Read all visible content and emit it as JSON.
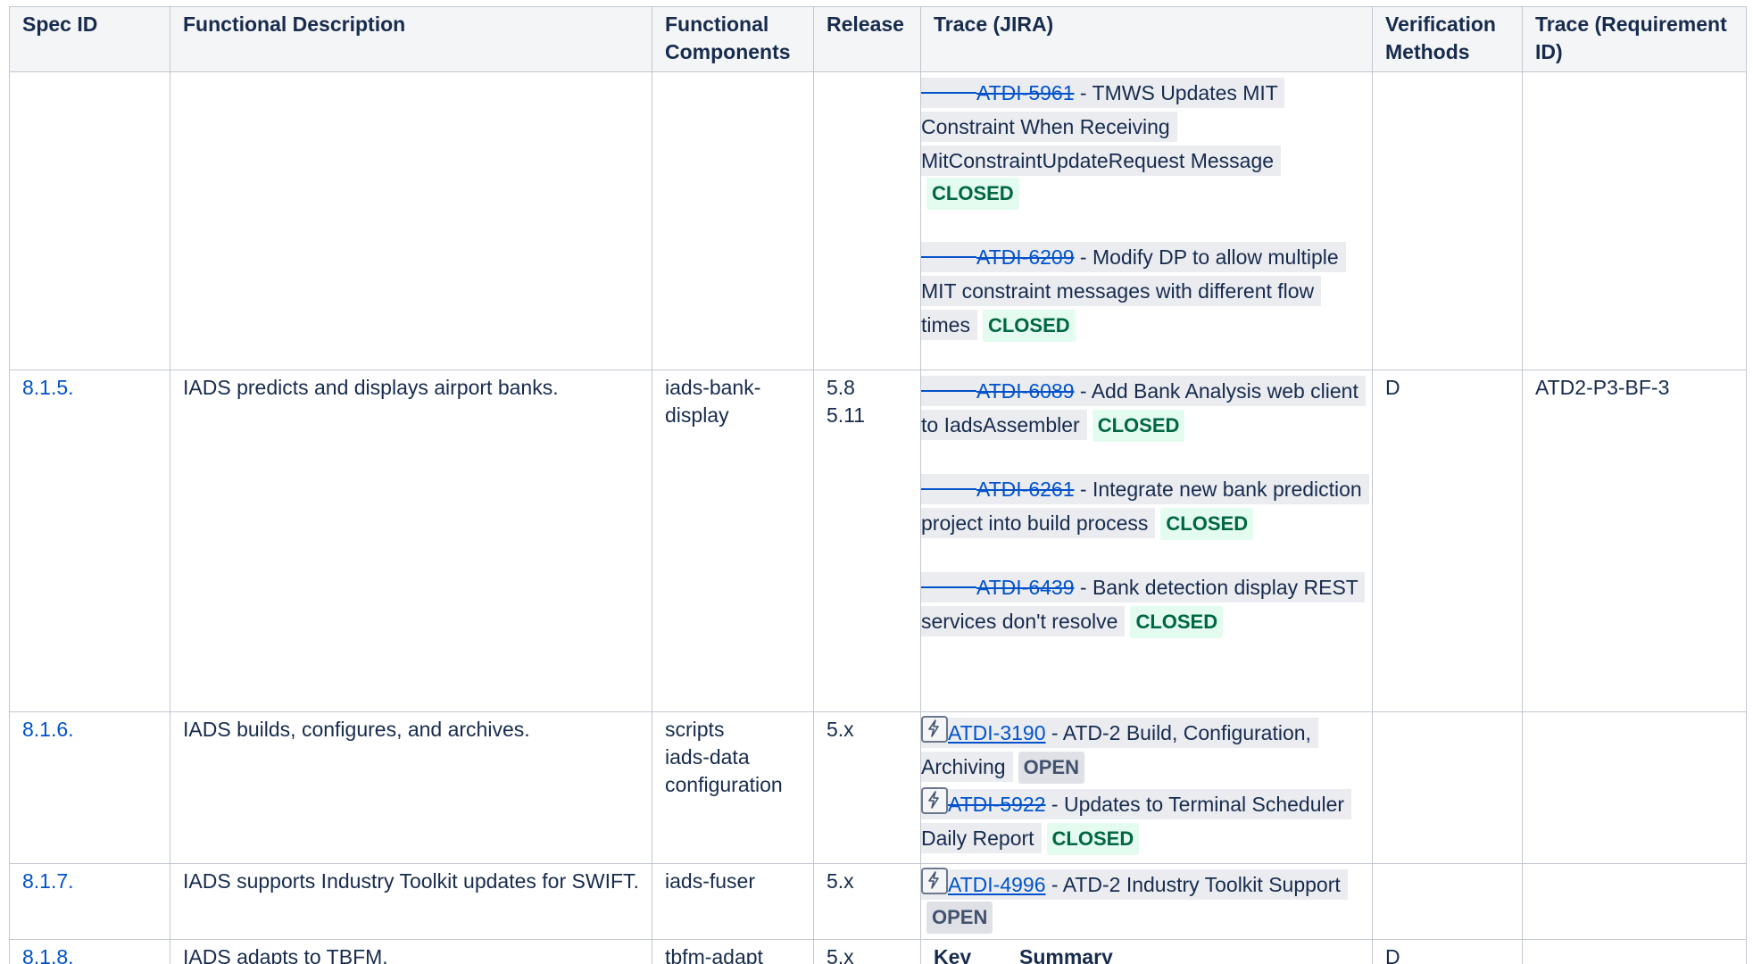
{
  "headers": [
    "Spec ID",
    "Functional Description",
    "Functional Components",
    "Release",
    "Trace (JIRA)",
    "Verification Methods",
    "Trace (Requirement ID)"
  ],
  "rows": [
    {
      "spec_id": "",
      "description": "",
      "components": [],
      "release": [],
      "issues": [
        {
          "key": "ATDI-5961",
          "summary": "TMWS Updates MIT Constraint When Receiving MitConstraintUpdateRequest Message",
          "status": "CLOSED",
          "resolved": true,
          "icon": ""
        },
        {
          "key": "ATDI-6209",
          "summary": "Modify DP to allow multiple MIT constraint messages with different flow times",
          "status": "CLOSED",
          "resolved": true,
          "icon": ""
        }
      ],
      "verification": "",
      "requirement": ""
    },
    {
      "spec_id": "8.1.5.",
      "description": "IADS predicts and displays airport banks.",
      "components": [
        "iads-bank-display"
      ],
      "release": [
        "5.8",
        "5.11"
      ],
      "issues": [
        {
          "key": "ATDI-6089",
          "summary": "Add Bank Analysis web client to IadsAssembler",
          "status": "CLOSED",
          "resolved": true,
          "icon": ""
        },
        {
          "key": "ATDI-6261",
          "summary": "Integrate new bank prediction project into build process",
          "status": "CLOSED",
          "resolved": true,
          "icon": ""
        },
        {
          "key": "ATDI-6439",
          "summary": "Bank detection display REST services don't resolve",
          "status": "CLOSED",
          "resolved": true,
          "icon": ""
        }
      ],
      "verification": "D",
      "requirement": "ATD2-P3-BF-3"
    },
    {
      "spec_id": "8.1.6.",
      "description": "IADS builds, configures, and archives.",
      "components": [
        "scripts",
        "iads-data",
        "configuration"
      ],
      "release": [
        "5.x"
      ],
      "issues": [
        {
          "key": "ATDI-3190",
          "summary": "ATD-2 Build, Configuration, Archiving",
          "status": "OPEN",
          "resolved": false,
          "icon": "epic-lightning-icon"
        },
        {
          "key": "ATDI-5922",
          "summary": "Updates to Terminal Scheduler Daily Report",
          "status": "CLOSED",
          "resolved": true,
          "icon": "epic-lightning-icon"
        }
      ],
      "verification": "",
      "requirement": ""
    },
    {
      "spec_id": "8.1.7.",
      "description": "IADS supports Industry Toolkit updates for SWIFT.",
      "components": [
        "iads-fuser"
      ],
      "release": [
        "5.x"
      ],
      "issues": [
        {
          "key": "ATDI-4996",
          "summary": "ATD-2 Industry Toolkit Support",
          "status": "OPEN",
          "resolved": false,
          "icon": "epic-lightning-icon"
        }
      ],
      "verification": "",
      "requirement": ""
    },
    {
      "spec_id": "8.1.8.",
      "description": "IADS adapts to TBFM.",
      "components": [
        "tbfm-adapt"
      ],
      "release": [
        "5.x"
      ],
      "subtable_headers": [
        "Key",
        "Summary"
      ],
      "verification": "D",
      "requirement": ""
    }
  ],
  "colors": {
    "link": "#0052cc",
    "closed_bg": "#e3fcef",
    "closed_fg": "#006644",
    "open_bg": "#dfe1e6",
    "open_fg": "#42526e",
    "header_bg": "#f4f5f7",
    "border": "#c1c7d0"
  }
}
